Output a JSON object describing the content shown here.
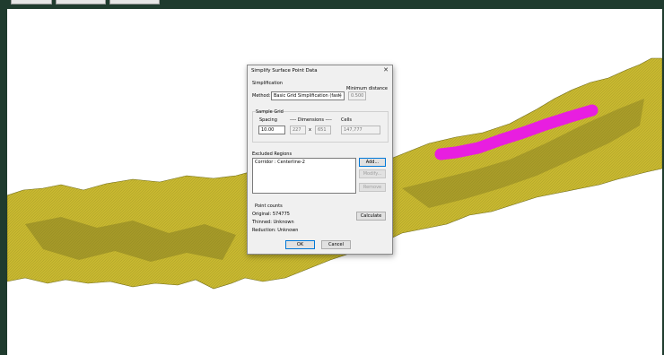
{
  "dialog": {
    "title": "Simplify Surface Point Data",
    "close_glyph": "✕",
    "simplification": {
      "group_label": "Simplification",
      "method_label": "Method:",
      "method_value": "Basic Grid Simplification (fast)",
      "dropdown_glyph": "⌄",
      "min_distance_label": "Minimum distance",
      "min_distance_value": "0.500"
    },
    "sample_grid": {
      "group_label": "Sample Grid",
      "spacing_label": "Spacing",
      "spacing_value": "10.00",
      "dimensions_label": "---- Dimensions ----",
      "dim_x": "227",
      "x_sep": "x",
      "dim_y": "651",
      "cells_label": "Cells",
      "cells_value": "147,777"
    },
    "excluded": {
      "group_label": "Excluded Regions",
      "items": [
        "Corridor : Centerline-2"
      ],
      "add_label": "Add...",
      "modify_label": "Modify...",
      "remove_label": "Remove"
    },
    "point_counts": {
      "group_label": "Point counts",
      "original": "Original: 574775",
      "thinned": "Thinned: Unknown",
      "reduction": "Reduction: Unknown",
      "calculate_label": "Calculate"
    },
    "ok_label": "OK",
    "cancel_label": "Cancel"
  },
  "colors": {
    "terrain": "#c8b830",
    "terrain_shadow": "#6e6a1a",
    "corridor": "#e81ee0",
    "background": "#ffffff",
    "frame": "#1f3b2e"
  }
}
